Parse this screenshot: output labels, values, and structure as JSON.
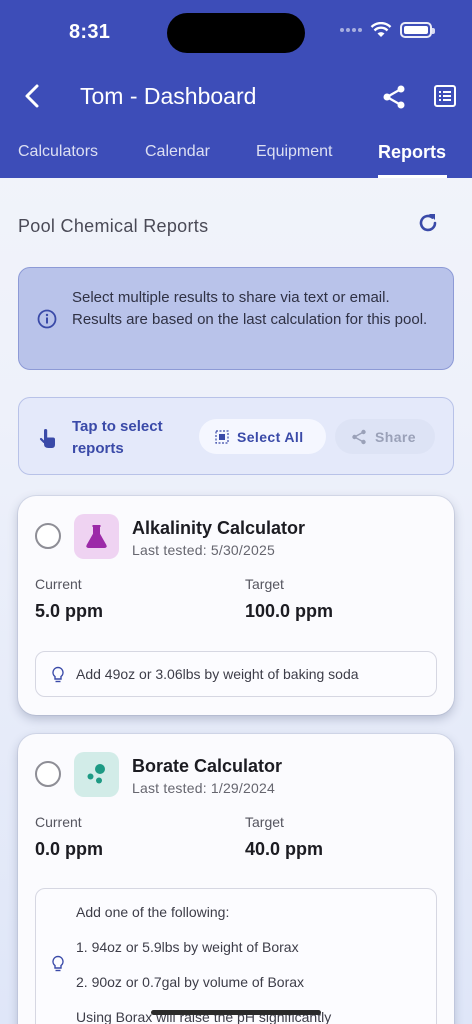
{
  "status_bar": {
    "time": "8:31"
  },
  "header": {
    "title": "Tom - Dashboard",
    "tabs": [
      {
        "label": "Calculators",
        "active": false
      },
      {
        "label": "Calendar",
        "active": false
      },
      {
        "label": "Equipment",
        "active": false
      },
      {
        "label": "Reports",
        "active": true
      }
    ]
  },
  "section": {
    "title": "Pool Chemical Reports"
  },
  "info": {
    "text": "Select multiple results to share via text or email. Results are based on the last calculation for this pool."
  },
  "selection": {
    "hint": "Tap to select reports",
    "select_all_label": "Select All",
    "share_label": "Share"
  },
  "reports": [
    {
      "name": "Alkalinity Calculator",
      "last_tested": "Last tested: 5/30/2025",
      "current_label": "Current",
      "current_value": "5.0 ppm",
      "target_label": "Target",
      "target_value": "100.0 ppm",
      "icon": "flask-icon",
      "icon_color": "#9c2aa8",
      "icon_bg": "#efd3f2",
      "tip": "Add 49oz or 3.06lbs by weight of baking soda"
    },
    {
      "name": "Borate Calculator",
      "last_tested": "Last tested: 1/29/2024",
      "current_label": "Current",
      "current_value": "0.0 ppm",
      "target_label": "Target",
      "target_value": "40.0 ppm",
      "icon": "molecule-icon",
      "icon_color": "#1e9a84",
      "icon_bg": "#d2ece8",
      "tip_lines": [
        "Add one of the following:",
        "1. 94oz or 5.9lbs by weight of Borax",
        "2. 90oz or 0.7gal by volume of Borax",
        "Using Borax will raise the pH significantly"
      ]
    }
  ],
  "colors": {
    "primary": "#3d4db8",
    "info_bg": "#b9c3ea",
    "accent_text": "#3a4aa8"
  }
}
